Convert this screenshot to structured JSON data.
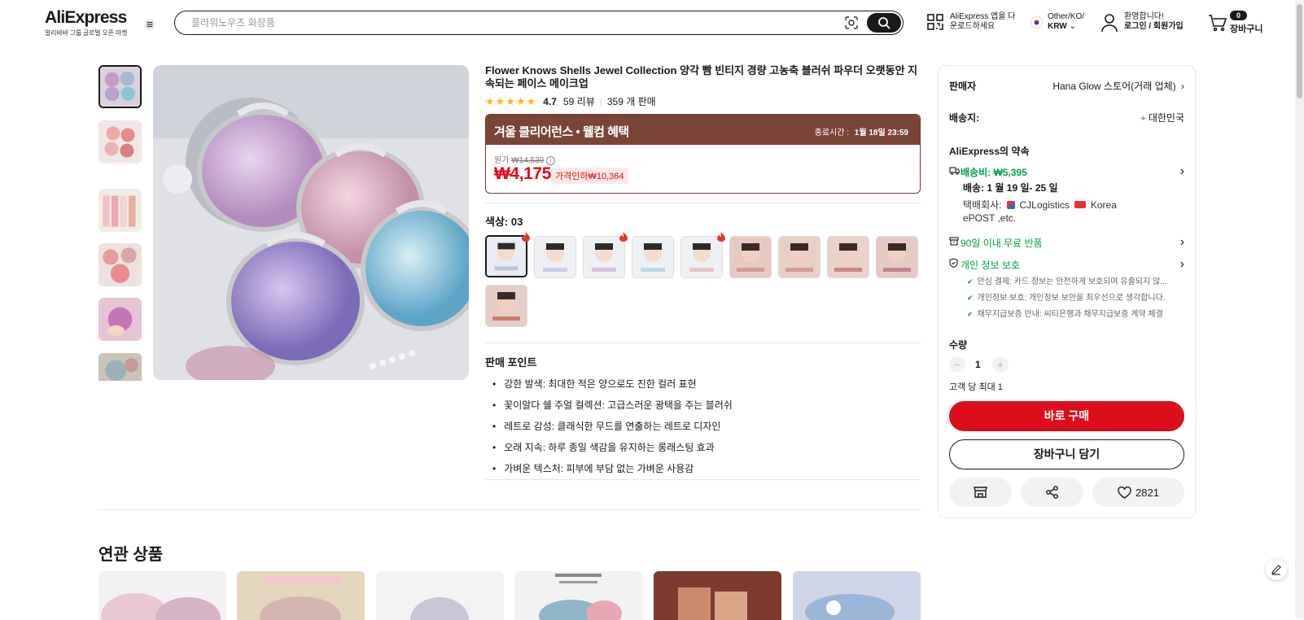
{
  "header": {
    "logo": "AliExpress",
    "logo_sub": "알리바바 그룹 글로벌 오픈 마켓",
    "search_placeholder": "플라워노우즈 화장품",
    "app_line1": "AliExpress 앱을 다",
    "app_line2": "운로드하세요",
    "locale_line1": "Other/KO/",
    "locale_line2": "KRW",
    "account_line1": "환영합니다!",
    "account_line2": "로그인 / 회원가입",
    "cart_count": "0",
    "cart_label": "장바구니"
  },
  "product": {
    "title": "Flower Knows Shells Jewel Collection 양각 빰 빈티지 경량 고농축 블러쉬 파우더 오랫동안 지속되는 페이스 메이크업",
    "rating": "4.7",
    "reviews": "59 리뷰",
    "sold": "359 개 판매",
    "deal_title": "겨울 클리어런스 • 웰컴 혜택",
    "deal_end_label": "종료시간 :",
    "deal_end_time": "1월 18일 23:59",
    "orig_label": "원가",
    "orig_price": "₩14,539",
    "price": "₩4,175",
    "discount": "가격인하₩10,364",
    "color_label": "색상: 03",
    "points_title": "판매 포인트",
    "points": [
      "강한 발색: 최대한 적은 양으로도 진한 컬러 표현",
      "꽃이알다 쉘 주얼 컬렉션: 고급스러운 광택을 주는 블러쉬",
      "레트로 감성: 클래식한 무드를 연출하는 레트로 디자인",
      "오래 지속: 하루 종일 색감을 유지하는 롱래스팅 효과",
      "가벼운 텍스처: 피부에 부담 없는 가벼운 사용감"
    ]
  },
  "panel": {
    "seller_label": "판매자",
    "seller_value": "Hana Glow 스토어(거래 업체)",
    "ship_to_label": "배송지:",
    "ship_to_value": "대한민국",
    "promise_label": "AliExpress의 약속",
    "shipping_fee": "배송비: ₩5,395",
    "delivery": "배송: 1 월 19 일- 25 일",
    "courier_label": "택배회사:",
    "courier_1": "CJLogistics",
    "courier_2": "Korea",
    "courier_3": "ePOST ,etc.",
    "return": "90일 이내 무료 반품",
    "privacy": "개인 정보 보호",
    "privacy_items": [
      "안심 결제: 카드 정보는 안전하게 보호되며 유출되지 않...",
      "개인정보 보호: 개인정보 보안을 최우선으로 생각합니다.",
      "채무지급보증 안내: 씨티은행과 채무지급보증 계약 체결"
    ],
    "qty_label": "수량",
    "qty_value": "1",
    "qty_limit": "고객 당 최대 1",
    "buy_now": "바로 구매",
    "add_cart": "장바구니 담기",
    "wishlist_count": "2821"
  },
  "related": {
    "title": "연관 상품"
  },
  "colors": {
    "accent_red": "#dd0e1c",
    "deal_brown": "#7a4536",
    "green": "#00a046",
    "star": "#fdb813"
  }
}
